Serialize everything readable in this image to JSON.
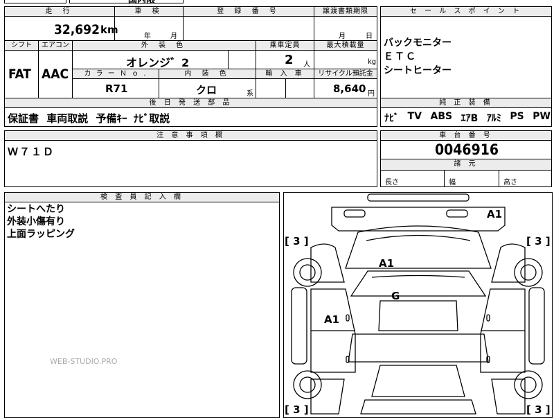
{
  "header": {
    "mileage_label": "走 行",
    "inspection_label": "車 検",
    "registration_label": "登 録 番 号",
    "transfer_deadline_label": "譲渡書類期限",
    "sales_point_label": "セ ー ル ス ポ イ ン ト",
    "top_fragment": "国内限"
  },
  "mileage": {
    "value": "32,692",
    "unit": "km"
  },
  "inspection": {
    "year_label": "年",
    "month_label": "月"
  },
  "transfer": {
    "month_label": "月",
    "day_label": "日"
  },
  "specs": {
    "shift_label": "シフト",
    "aircon_label": "エアコン",
    "exterior_color_label": "外 装 色",
    "capacity_label": "乗車定員",
    "max_load_label": "最大積載量",
    "shift": "FAT",
    "aircon": "AAC",
    "exterior_color": "オレンジ゛2",
    "capacity": "2",
    "capacity_unit": "人",
    "max_load_unit": "kg",
    "color_no_label": "カ ラ ー Ｎ ｏ .",
    "interior_color_label": "内 装 色",
    "import_label": "輸 入 車",
    "recycle_label": "リサイクル預託金",
    "color_no": "R71",
    "interior_color": "クロ",
    "interior_suffix": "系",
    "recycle_fee": "8,640",
    "recycle_unit": "円"
  },
  "sales_points": [
    "バックモニター",
    "ＥＴＣ",
    "シートヒーター"
  ],
  "later_parts": {
    "label": "後 日 発 送 部 品",
    "items": [
      "保証書",
      "車両取説",
      "予備ｷｰ",
      "ﾅﾋﾞ取説"
    ]
  },
  "equipment": {
    "label": "純 正 装 備",
    "items": [
      "ﾅﾋﾞ",
      "TV",
      "ABS",
      "ｴｱB",
      "ｱﾙﾐ",
      "PS",
      "PW"
    ]
  },
  "notes": {
    "label": "注 意 事 項 欄",
    "text": "Ｗ７１Ｄ"
  },
  "chassis": {
    "label": "車 台 番 号",
    "number": "0046916"
  },
  "dimensions": {
    "label": "諸 元",
    "length_label": "長さ",
    "width_label": "幅",
    "height_label": "高さ"
  },
  "inspector": {
    "label": "検 査 員 記 入 欄",
    "lines": [
      "シートへたり",
      "外装小傷有り",
      "上面ラッピング"
    ]
  },
  "diagram": {
    "marks": [
      "A1",
      "A1",
      "G",
      "A1"
    ],
    "tires": [
      "[ 3 ]",
      "[ 3 ]",
      "[ 3 ]",
      "[ 3 ]"
    ]
  },
  "watermark": "WEB-STUDIO.PRO"
}
